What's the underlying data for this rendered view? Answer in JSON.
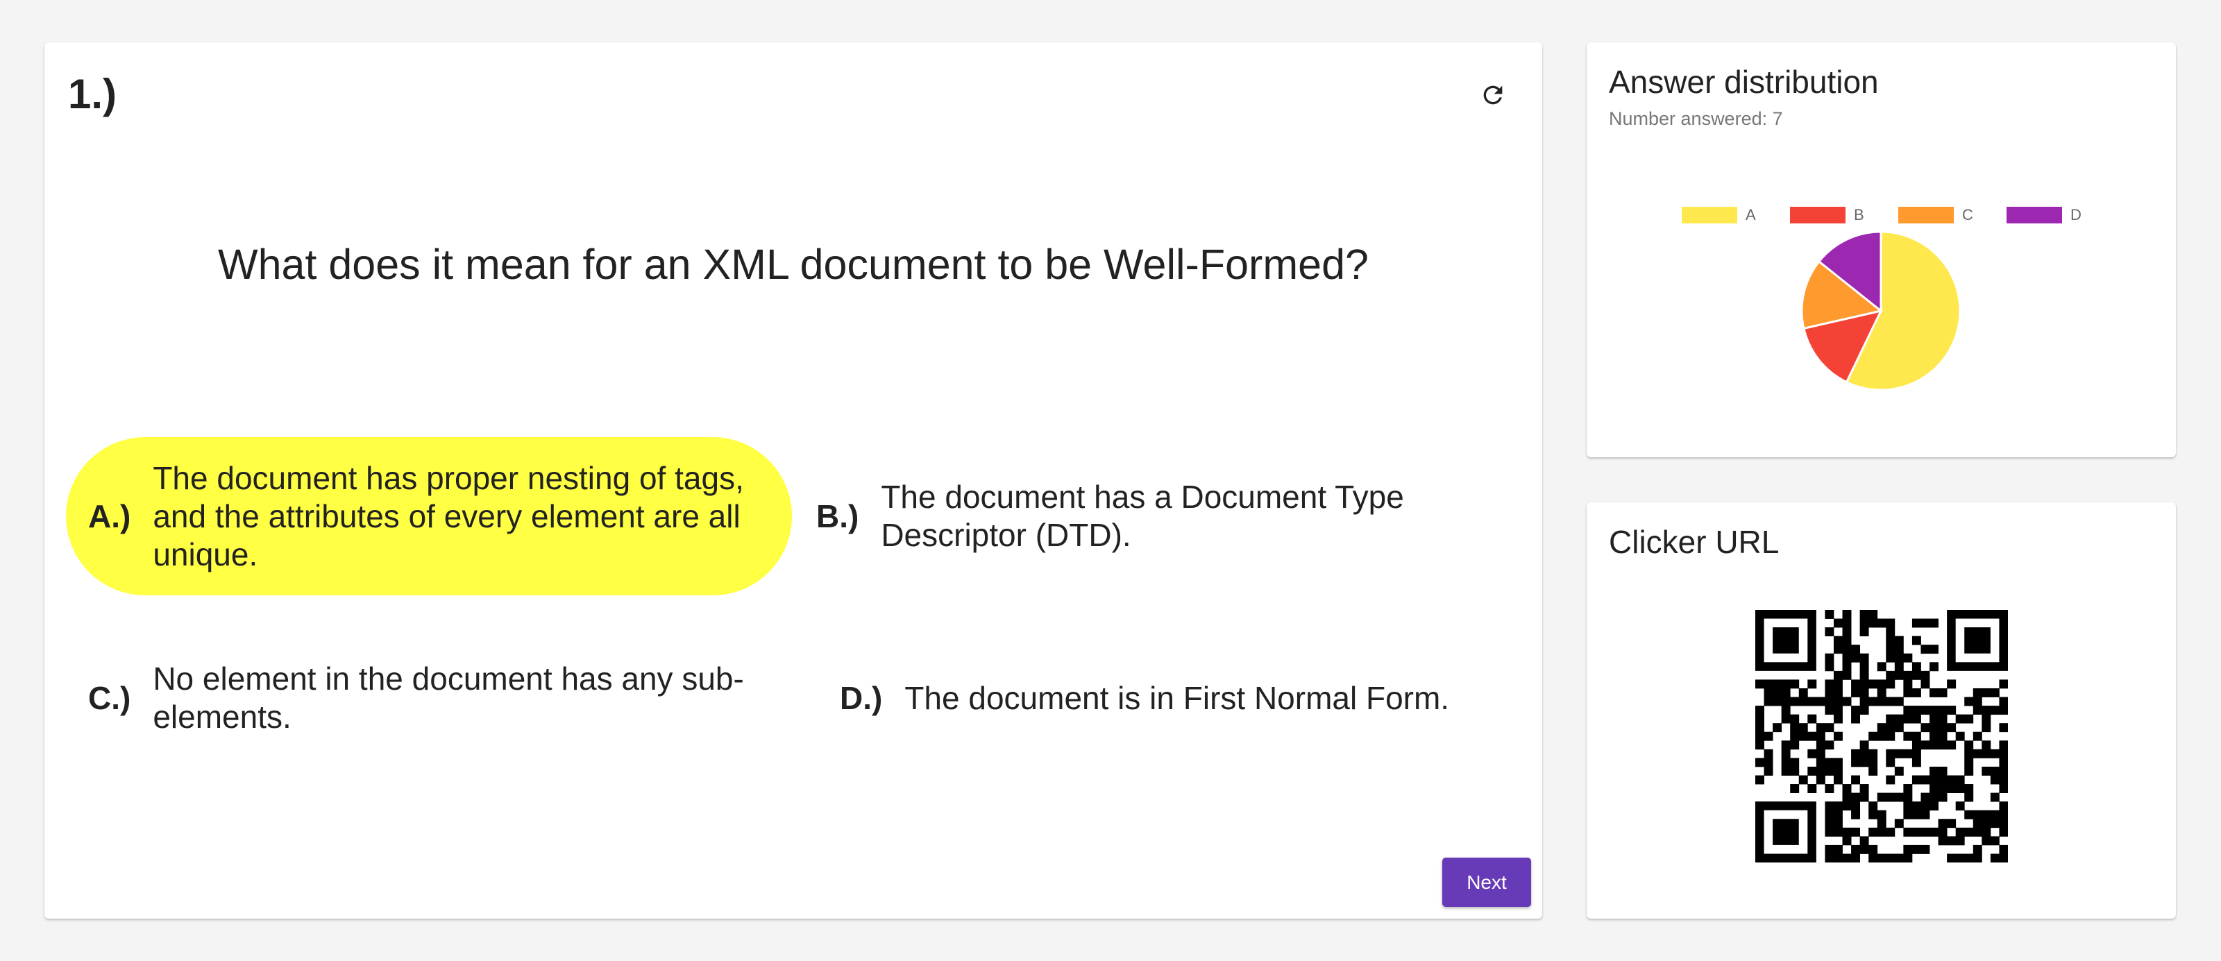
{
  "question": {
    "number": "1.)",
    "text": "What does it mean for an XML document to be Well-Formed?",
    "options": [
      {
        "letter": "A.)",
        "text": "The document has proper nesting of tags, and the attributes of every element are all unique.",
        "highlighted": true
      },
      {
        "letter": "B.)",
        "text": "The document has a Document Type Descriptor (DTD)."
      },
      {
        "letter": "C.)",
        "text": "No element in the document has any sub-elements."
      },
      {
        "letter": "D.)",
        "text": "The document is in First Normal Form."
      }
    ],
    "next_label": "Next",
    "refresh_icon": "refresh-icon"
  },
  "distribution": {
    "title": "Answer distribution",
    "answered": "Number answered: 7"
  },
  "clicker": {
    "title": "Clicker URL"
  },
  "colors": {
    "accent": "#673ab7",
    "highlight": "#ffff44"
  },
  "chart_data": {
    "type": "pie",
    "labels": [
      "A",
      "B",
      "C",
      "D"
    ],
    "values": [
      4,
      1,
      1,
      1
    ],
    "colors": [
      "#ffe84d",
      "#f44336",
      "#ff9a2e",
      "#9c27b0"
    ],
    "legend": "top"
  }
}
